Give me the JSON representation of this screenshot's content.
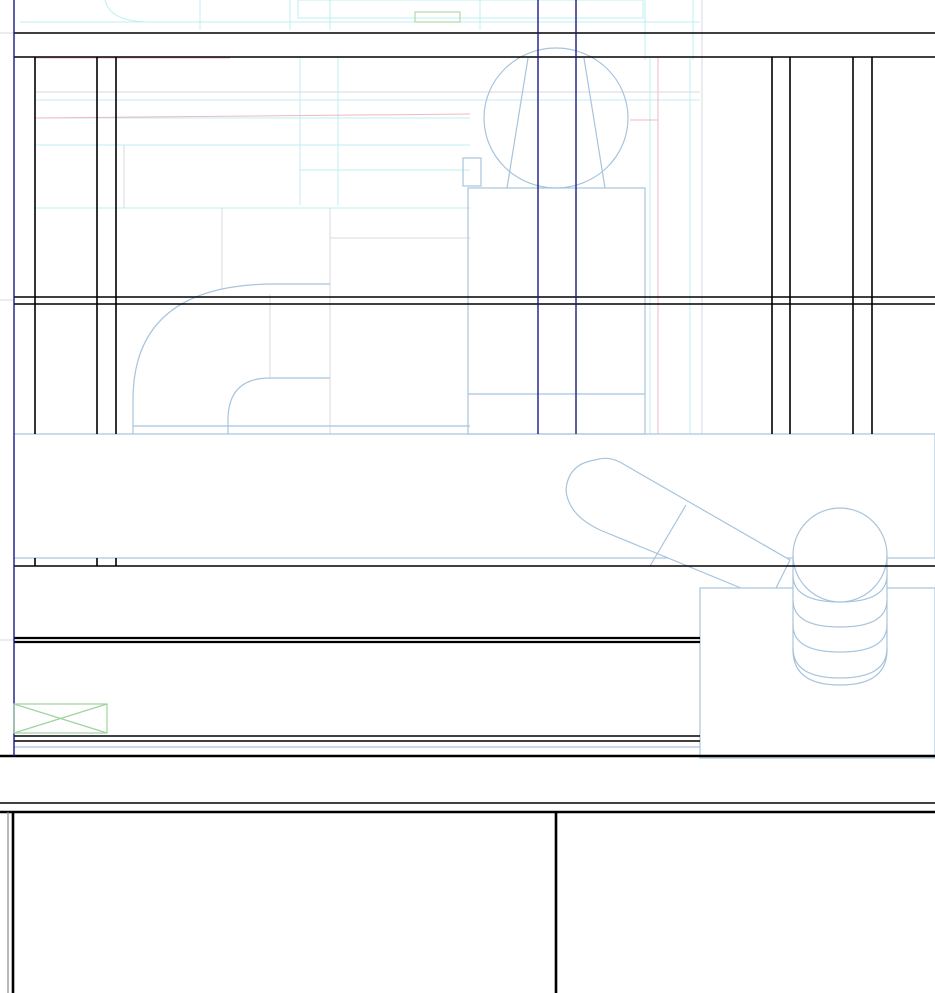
{
  "drawing": {
    "view": "cad-elevation-viewport",
    "layers": {
      "structure": {
        "color": "#000000",
        "label": ""
      },
      "gridline": {
        "color": "#1a1a8c",
        "label": ""
      },
      "ductwork": {
        "color": "#a8c4dc",
        "label": ""
      },
      "background_underlay_cyan": {
        "color": "#bfeff2",
        "label": ""
      },
      "background_underlay_pink": {
        "color": "#f0b8c4",
        "label": ""
      },
      "background_underlay_grey": {
        "color": "#d8d8e0",
        "label": ""
      },
      "void_marker": {
        "color": "#9fd39f",
        "label": ""
      }
    },
    "title_block": {
      "left_cell_text": "",
      "right_cell_text": ""
    }
  }
}
